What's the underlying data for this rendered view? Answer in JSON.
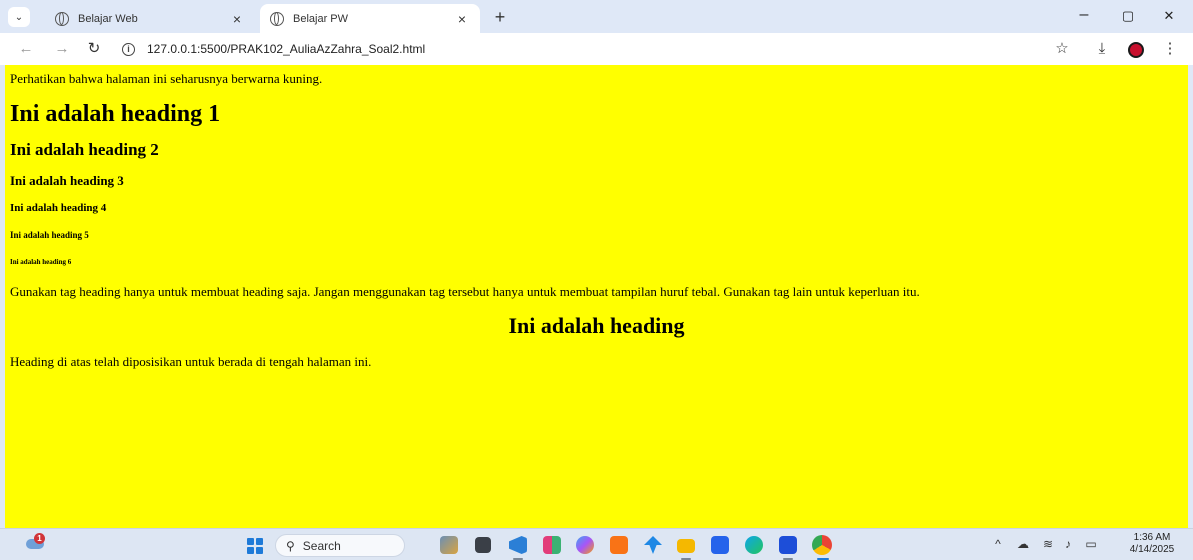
{
  "browser": {
    "tabs": [
      {
        "title": "Belajar Web",
        "active": false
      },
      {
        "title": "Belajar PW",
        "active": true
      }
    ],
    "tab_close": "×",
    "new_tab": "+",
    "address": "127.0.0.1:5500/PRAK102_AuliaAzZahra_Soal2.html",
    "window_controls": {
      "minimize": "–",
      "restore": "▢",
      "close": "✕"
    },
    "icons": {
      "back": "back-arrow-icon",
      "forward": "forward-arrow-icon",
      "reload": "reload-icon",
      "info": "info-icon",
      "bookmark": "star-icon",
      "download": "download-icon",
      "menu": "kebab-menu-icon"
    }
  },
  "page": {
    "background": "#ffff00",
    "intro": "Perhatikan bahwa halaman ini seharusnya berwarna kuning.",
    "h1": "Ini adalah heading 1",
    "h2": "Ini adalah heading 2",
    "h3": "Ini adalah heading 3",
    "h4": "Ini adalah heading 4",
    "h5": "Ini adalah heading 5",
    "h6": "Ini adalah heading 6",
    "note": "Gunakan tag heading hanya untuk membuat heading saja. Jangan menggunakan tag tersebut hanya untuk membuat tampilan huruf tebal. Gunakan tag lain untuk keperluan itu.",
    "centered_heading": "Ini adalah heading",
    "outro": "Heading di atas telah diposisikan untuk berada di tengah halaman ini."
  },
  "taskbar": {
    "search_placeholder": "Search",
    "weather_badge": "1",
    "time": "1:36 AM",
    "date": "4/14/2025",
    "apps": [
      "app-icon",
      "file-explorer-icon",
      "vscode-icon",
      "app-icon",
      "copilot-icon",
      "xampp-icon",
      "app-icon",
      "folder-icon",
      "store-icon",
      "edge-icon",
      "word-icon",
      "chrome-icon"
    ]
  }
}
